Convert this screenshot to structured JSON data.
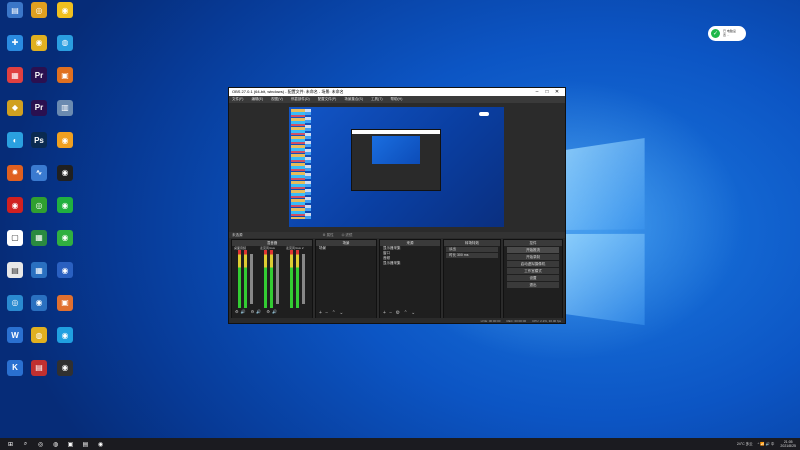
{
  "desktop": {
    "icons": [
      {
        "label": "",
        "glyph": "▤",
        "color": "#3a76c8"
      },
      {
        "label": "",
        "glyph": "◎",
        "color": "#e0a020"
      },
      {
        "label": "",
        "glyph": "◉",
        "color": "#f0c020"
      },
      {
        "label": "",
        "glyph": "✚",
        "color": "#2a8be0"
      },
      {
        "label": "",
        "glyph": "◉",
        "color": "#e0b020"
      },
      {
        "label": "",
        "glyph": "◍",
        "color": "#2a9ee0"
      },
      {
        "label": "",
        "glyph": "▦",
        "color": "#e04040"
      },
      {
        "label": "",
        "glyph": "Pr",
        "color": "#2a1050"
      },
      {
        "label": "",
        "glyph": "▣",
        "color": "#e07020"
      },
      {
        "label": "",
        "glyph": "◆",
        "color": "#d0a020"
      },
      {
        "label": "",
        "glyph": "Pr",
        "color": "#2a1050"
      },
      {
        "label": "",
        "glyph": "▥",
        "color": "#6a8ab0"
      },
      {
        "label": "",
        "glyph": "◐",
        "color": "#2aa0e0"
      },
      {
        "label": "",
        "glyph": "Ps",
        "color": "#0a2a50"
      },
      {
        "label": "",
        "glyph": "◉",
        "color": "#f0a020"
      },
      {
        "label": "",
        "glyph": "✹",
        "color": "#e06020"
      },
      {
        "label": "",
        "glyph": "∿",
        "color": "#3a7ad0"
      },
      {
        "label": "",
        "glyph": "◉",
        "color": "#202020"
      },
      {
        "label": "",
        "glyph": "◉",
        "color": "#d02020"
      },
      {
        "label": "",
        "glyph": "◎",
        "color": "#30a030"
      },
      {
        "label": "",
        "glyph": "◉",
        "color": "#20b040"
      },
      {
        "label": "",
        "glyph": "▢",
        "color": "#ffffff"
      },
      {
        "label": "",
        "glyph": "▦",
        "color": "#2a8a40"
      },
      {
        "label": "",
        "glyph": "◉",
        "color": "#30b040"
      },
      {
        "label": "",
        "glyph": "▤",
        "color": "#e8e8e8"
      },
      {
        "label": "",
        "glyph": "▦",
        "color": "#2a70c0"
      },
      {
        "label": "",
        "glyph": "◉",
        "color": "#2a60c0"
      },
      {
        "label": "",
        "glyph": "◎",
        "color": "#2a8ad0"
      },
      {
        "label": "",
        "glyph": "◉",
        "color": "#2a70c0"
      },
      {
        "label": "",
        "glyph": "▣",
        "color": "#e07030"
      },
      {
        "label": "",
        "glyph": "W",
        "color": "#2a70d0"
      },
      {
        "label": "",
        "glyph": "◍",
        "color": "#e0b020"
      },
      {
        "label": "",
        "glyph": "◉",
        "color": "#20a0e0"
      },
      {
        "label": "",
        "glyph": "K",
        "color": "#2a70d0"
      },
      {
        "label": "",
        "glyph": "▤",
        "color": "#c03030"
      },
      {
        "label": "",
        "glyph": "◉",
        "color": "#303030"
      }
    ]
  },
  "notification": {
    "icon": "wechat-icon",
    "text": "已 电脑设\n置 ..."
  },
  "obs": {
    "title": "OBS 27.0.1 (64-bit, windows) - 配置文件: 未命名 - 场景: 未命名",
    "window_buttons": [
      "–",
      "□",
      "✕"
    ],
    "menu": [
      "文件(F)",
      "编辑(E)",
      "视图(V)",
      "停靠部件(D)",
      "配置文件(P)",
      "场景集合(S)",
      "工具(T)",
      "帮助(H)"
    ],
    "studio_label": "未选源",
    "dock_prop": "⚙ 属性",
    "dock_filter": "⛭ 滤镜",
    "panels": {
      "mixer": {
        "title": "混音器",
        "channels": [
          "桌面音频",
          "麦克风/Aux",
          "麦克风/Aux 2"
        ]
      },
      "scenes": {
        "title": "场景",
        "items": [
          "场景"
        ],
        "footer": "+ − ⌃ ⌄"
      },
      "sources": {
        "title": "来源",
        "items": [
          "显示器采集",
          "窗口",
          "音频",
          "显示器采集"
        ],
        "footer": "+ − ⚙ ⌃ ⌄"
      },
      "transitions": {
        "title": "转场特效",
        "items": [
          "淡出",
          "时长  300 ms"
        ]
      },
      "controls": {
        "title": "控件",
        "buttons": [
          "开始推流",
          "开始录制",
          "启动虚拟摄像机",
          "工作室模式",
          "设置",
          "退出"
        ]
      }
    },
    "status": [
      "LIVE: 00:00:00",
      "REC: 00:00:00",
      "CPU: 2.2%, 30.00 fps"
    ]
  },
  "taskbar": {
    "icons": [
      {
        "glyph": "⊞",
        "name": "start-icon"
      },
      {
        "glyph": "⌕",
        "name": "search-icon"
      },
      {
        "glyph": "◎",
        "name": "app-icon"
      },
      {
        "glyph": "◍",
        "name": "browser-icon"
      },
      {
        "glyph": "▣",
        "name": "app-icon"
      },
      {
        "glyph": "▤",
        "name": "app-icon"
      },
      {
        "glyph": "◉",
        "name": "obs-icon"
      }
    ],
    "weather": "24°C 多云",
    "tray": "^ 📶 🔊 中",
    "time": "21:05",
    "date": "2021/8/25"
  }
}
